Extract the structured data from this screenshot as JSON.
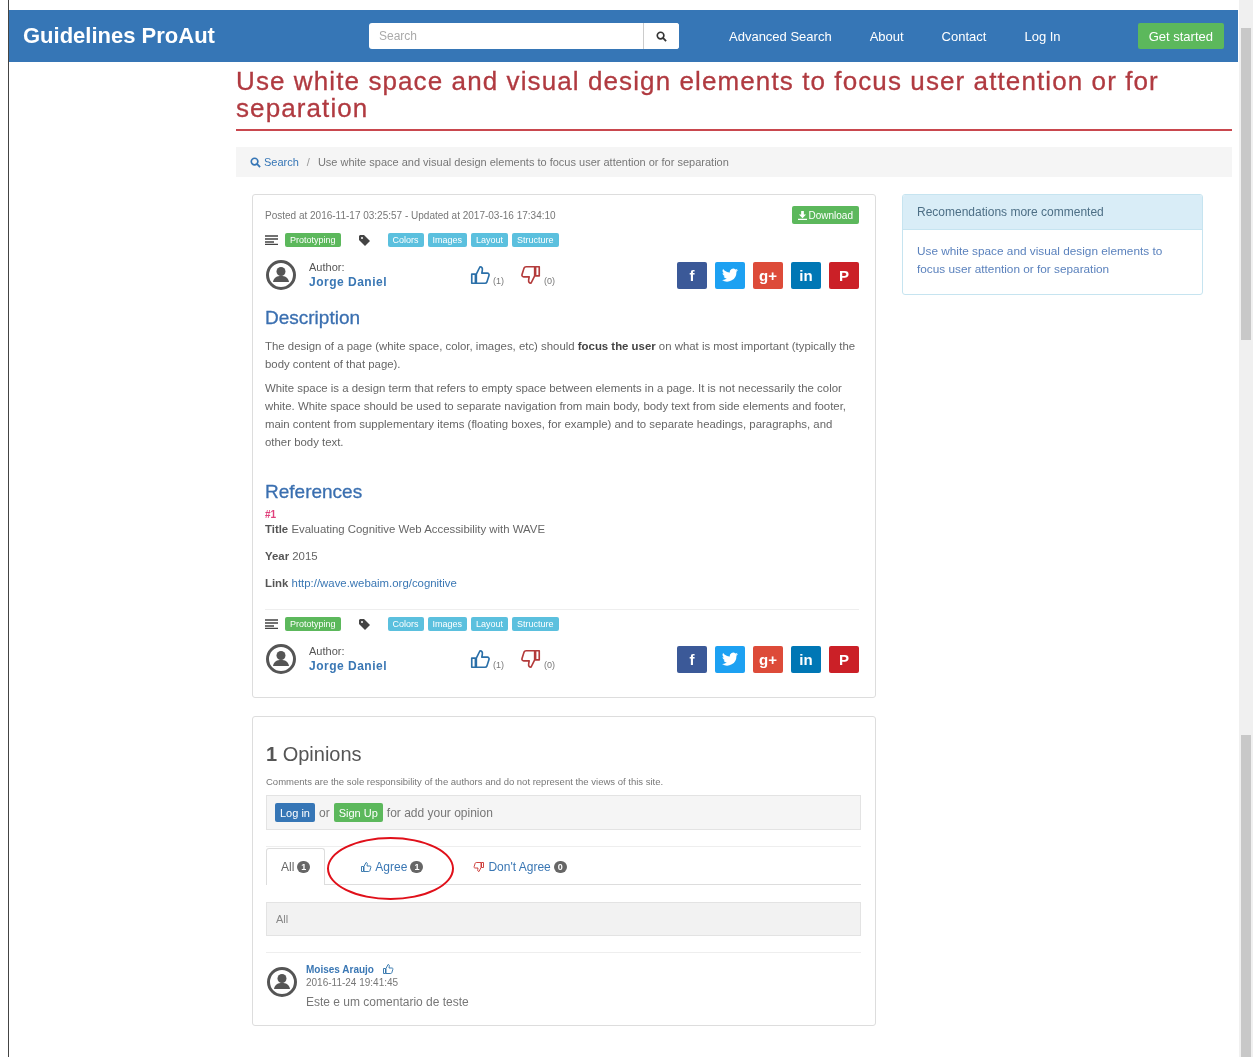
{
  "navbar": {
    "brand": "Guidelines ProAut",
    "search": {
      "placeholder": "Search"
    },
    "links": [
      {
        "label": "Advanced Search"
      },
      {
        "label": "About"
      },
      {
        "label": "Contact"
      },
      {
        "label": "Log In"
      }
    ],
    "cta": "Get started"
  },
  "title": "Use white space and visual design elements to focus user attention or for separation",
  "breadcrumb": {
    "separator": "/",
    "items": [
      {
        "label": "Search",
        "kind": "link"
      },
      {
        "label": "Use white space and visual design elements to focus user attention or for separation",
        "kind": "current"
      }
    ]
  },
  "article": {
    "meta": "Posted at 2016-11-17 03:25:57 - Updated at 2017-03-16 17:34:10",
    "download": "Download",
    "header": {
      "category": "Prototyping",
      "tags": [
        "Colors",
        "Images",
        "Layout",
        "Structure"
      ],
      "author_label": "Author:",
      "author": "Jorge Daniel",
      "likes": "(1)",
      "dislikes": "(0)",
      "share": [
        {
          "kind": "facebook",
          "glyph": "f"
        },
        {
          "kind": "twitter"
        },
        {
          "kind": "google",
          "glyph": "g+"
        },
        {
          "kind": "linkedin",
          "glyph": "in"
        },
        {
          "kind": "pinterest",
          "glyph": "P"
        }
      ]
    },
    "description_heading": "Description",
    "paragraphs": [
      "The design of a page (white space, color, images, etc) should **focus the user** on what is most important (typically the body content of that page).",
      "White space is a design term that refers to empty space between elements in a page. It is not necessarily the color white. White space should be used to separate navigation from main body, body text from side elements and footer, main content from supplementary items (floating boxes, for example) and to separate headings, paragraphs, and other body text."
    ],
    "references_heading": "References",
    "references": [
      {
        "number": "#1",
        "title_label": "Title",
        "title": "Evaluating Cognitive Web Accessibility with WAVE",
        "year_label": "Year",
        "year": "2015",
        "link_label": "Link",
        "link": "http://wave.webaim.org/cognitive"
      }
    ],
    "footer": {
      "category": "Prototyping",
      "tags": [
        "Colors",
        "Images",
        "Layout",
        "Structure"
      ],
      "author_label": "Author:",
      "author": "Jorge Daniel",
      "likes": "(1)",
      "dislikes": "(0)",
      "share": [
        {
          "kind": "facebook",
          "glyph": "f"
        },
        {
          "kind": "twitter"
        },
        {
          "kind": "google",
          "glyph": "g+"
        },
        {
          "kind": "linkedin",
          "glyph": "in"
        },
        {
          "kind": "pinterest",
          "glyph": "P"
        }
      ]
    }
  },
  "sidebar": {
    "heading": "Recomendations more commented",
    "items": [
      "Use white space and visual design elements to focus user attention or for separation"
    ]
  },
  "opinions": {
    "heading": "**1** Opinions",
    "notice": "Comments are the sole responsibility of the authors and do not represent the views of this site.",
    "login": "Log in",
    "or": "or",
    "signup": "Sign Up",
    "prompt": "for add your opinion",
    "tabs": [
      {
        "kind": "all",
        "label": "All",
        "count": "1",
        "selected": true,
        "circled": false
      },
      {
        "kind": "agree",
        "label": "Agree",
        "count": "1",
        "selected": false,
        "circled": true
      },
      {
        "kind": "disagree",
        "label": "Don't Agree",
        "count": "0",
        "selected": false,
        "circled": false
      }
    ],
    "filter": "All",
    "comments": [
      {
        "author": "Moises Araujo",
        "agrees": true,
        "date": "2016-11-24 19:41:45",
        "text": "Este e um comentario de teste"
      }
    ]
  }
}
